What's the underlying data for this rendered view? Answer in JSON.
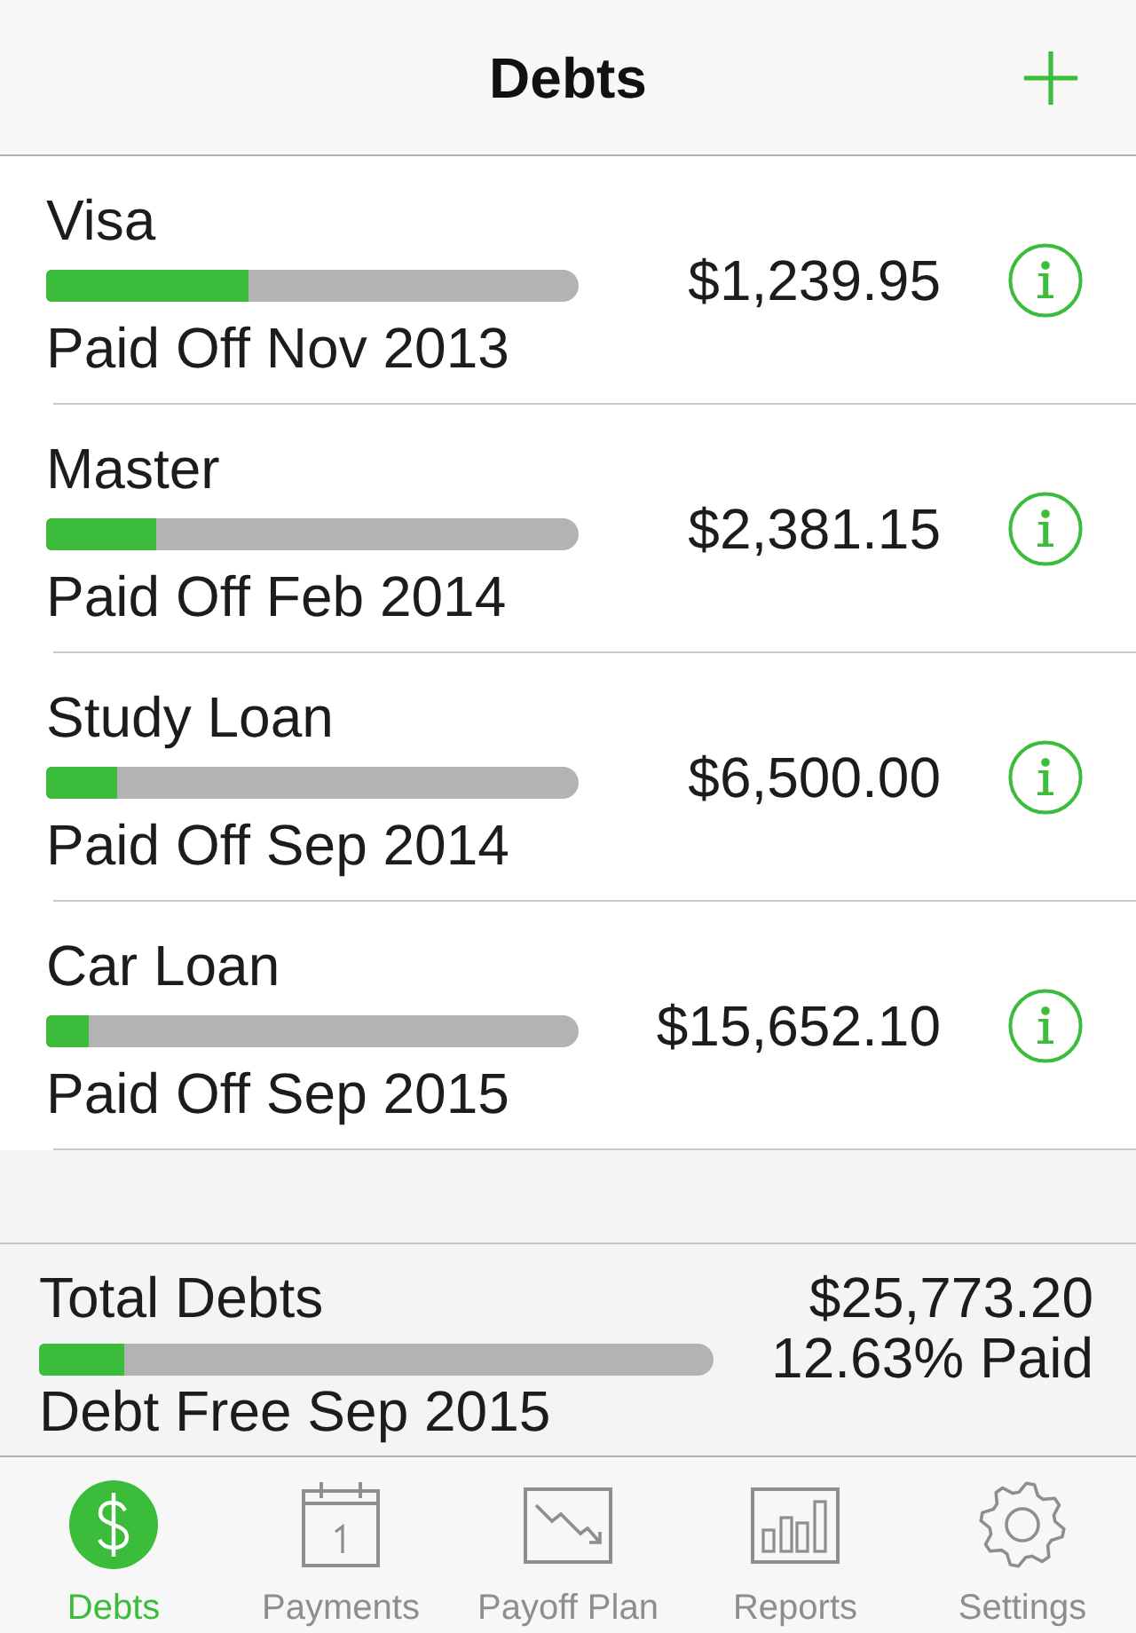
{
  "nav_bar": {
    "title": "Debts"
  },
  "debts": [
    {
      "name": "Visa",
      "level": 0.38,
      "paid_off": "Paid Off Nov 2013",
      "amount": "$1,239.95"
    },
    {
      "name": "Master",
      "level": 0.207,
      "paid_off": "Paid Off Feb 2014",
      "amount": "$2,381.15"
    },
    {
      "name": "Study Loan",
      "level": 0.133,
      "paid_off": "Paid Off Sep 2014",
      "amount": "$6,500.00"
    },
    {
      "name": "Car Loan",
      "level": 0.08,
      "paid_off": "Paid Off Sep 2015",
      "amount": "$15,652.10"
    }
  ],
  "summary": {
    "label": "Total Debts",
    "level": 0.1263,
    "debt_free": "Debt Free Sep 2015",
    "total": "$25,773.20",
    "paid": "12.63% Paid"
  },
  "tab_bar": [
    {
      "label": "Debts",
      "selected": true
    },
    {
      "label": "Payments",
      "selected": false
    },
    {
      "label": "Payoff Plan",
      "selected": false
    },
    {
      "label": "Reports",
      "selected": false
    },
    {
      "label": "Settings",
      "selected": false
    }
  ]
}
